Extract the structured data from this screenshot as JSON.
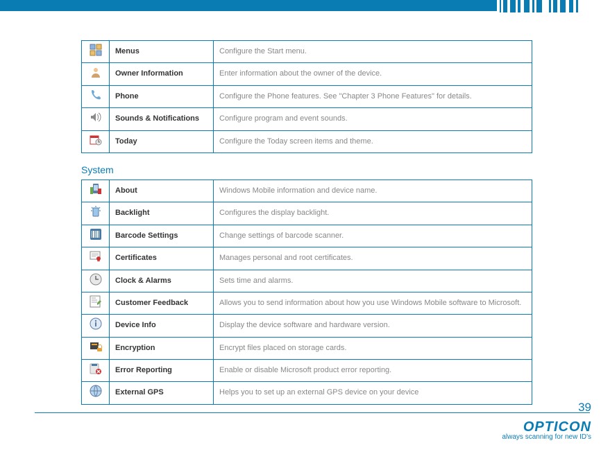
{
  "page_number": "39",
  "brand": {
    "name": "OPTICON",
    "tagline": "always scanning for new ID's"
  },
  "sections": [
    {
      "rows": [
        {
          "icon": "menus-icon",
          "name": "Menus",
          "desc": "Configure the Start menu."
        },
        {
          "icon": "owner-info-icon",
          "name": "Owner Information",
          "desc": "Enter information about the owner of the device."
        },
        {
          "icon": "phone-icon",
          "name": "Phone",
          "desc": "Configure the Phone features. See \"Chapter 3 Phone Features\" for details."
        },
        {
          "icon": "sounds-icon",
          "name": "Sounds & Notifications",
          "desc": "Configure program and event sounds."
        },
        {
          "icon": "today-icon",
          "name": "Today",
          "desc": "Configure the Today screen items and theme."
        }
      ]
    },
    {
      "title": "System",
      "rows": [
        {
          "icon": "about-icon",
          "name": "About",
          "desc": "Windows Mobile information and device name."
        },
        {
          "icon": "backlight-icon",
          "name": "Backlight",
          "desc": "Configures the display backlight."
        },
        {
          "icon": "barcode-icon",
          "name": "Barcode Settings",
          "desc": "Change settings of barcode scanner."
        },
        {
          "icon": "certificates-icon",
          "name": "Certificates",
          "desc": "Manages personal and root certificates."
        },
        {
          "icon": "clock-icon",
          "name": "Clock & Alarms",
          "desc": "Sets time and alarms."
        },
        {
          "icon": "feedback-icon",
          "name": "Customer Feedback",
          "desc": "Allows you to send information about how you use Windows Mobile software to Microsoft."
        },
        {
          "icon": "device-info-icon",
          "name": "Device Info",
          "desc": "Display the device software and hardware version."
        },
        {
          "icon": "encryption-icon",
          "name": "Encryption",
          "desc": "Encrypt files placed on storage cards."
        },
        {
          "icon": "error-report-icon",
          "name": "Error Reporting",
          "desc": "Enable or disable Microsoft product error reporting."
        },
        {
          "icon": "gps-icon",
          "name": "External GPS",
          "desc": "Helps you to set up an external GPS device on your device"
        }
      ]
    }
  ]
}
